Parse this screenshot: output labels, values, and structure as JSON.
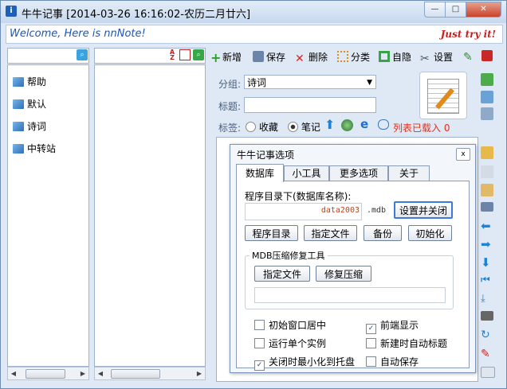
{
  "window": {
    "title": "牛牛记事 [2014-03-26 16:16:02-农历二月廿六]",
    "minimize_glyph": "—",
    "maximize_glyph": "□",
    "close_glyph": "✕"
  },
  "welcome": {
    "text": "Welcome, Here is nnNote!",
    "try_text": "Just try it!"
  },
  "categories": [
    {
      "label": "帮助"
    },
    {
      "label": "默认"
    },
    {
      "label": "诗词"
    },
    {
      "label": "中转站"
    }
  ],
  "toolbar": {
    "new_label": "新增",
    "save_label": "保存",
    "delete_label": "删除",
    "classify_label": "分类",
    "hide_label": "自隐",
    "settings_label": "设置"
  },
  "editor": {
    "group_label": "分组:",
    "group_value": "诗词",
    "title_label": "标题:",
    "title_value": "",
    "tag_label": "标签:",
    "radio_collect": "收藏",
    "radio_note": "笔记",
    "list_loaded": "列表已载入 0"
  },
  "dialog": {
    "title": "牛牛记事选项",
    "close_glyph": "x",
    "tabs": [
      {
        "label": "数据库",
        "active": true
      },
      {
        "label": "小工具",
        "active": false
      },
      {
        "label": "更多选项",
        "active": false
      },
      {
        "label": "关于",
        "active": false
      }
    ],
    "db_label": "程序目录下(数据库名称):",
    "db_name": "data2003",
    "db_ext": ".mdb",
    "set_close_button": "设置并关闭",
    "program_dir_button": "程序目录",
    "specify_file_button": "指定文件",
    "backup_button": "备份",
    "init_button": "初始化",
    "mdb_group_label": "MDB压缩修复工具",
    "mdb_specify_button": "指定文件",
    "mdb_repair_button": "修复压缩",
    "mdb_path": "",
    "options": [
      {
        "label": "初始窗口居中",
        "checked": false
      },
      {
        "label": "前端显示",
        "checked": true
      },
      {
        "label": "运行单个实例",
        "checked": false
      },
      {
        "label": "新建时自动标题",
        "checked": false
      },
      {
        "label": "关闭时最小化到托盘",
        "checked": true
      },
      {
        "label": "自动保存",
        "checked": false
      }
    ]
  },
  "colors": {
    "accent": "#1d56b3",
    "try_text": "#c81e1e",
    "list_loaded": "#e0301e",
    "db_name": "#c0401a"
  }
}
